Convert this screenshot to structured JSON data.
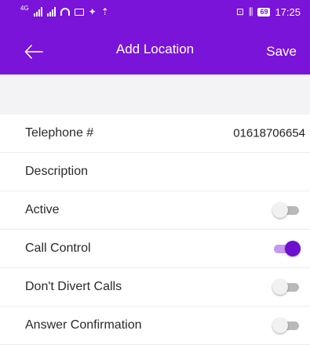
{
  "status_bar": {
    "network_label": "4G",
    "battery_level": "69",
    "time": "17:25"
  },
  "app_bar": {
    "title": "Add Location",
    "save_label": "Save",
    "back_icon": "arrow-left-icon"
  },
  "colors": {
    "primary": "#7a14d8",
    "toggle_on_thumb": "#6f0fd0",
    "toggle_on_track": "#c49af0",
    "toggle_off_track": "#b9b9b9",
    "toggle_off_thumb": "#f1f1f1"
  },
  "fields": {
    "telephone": {
      "label": "Telephone #",
      "value": "01618706654"
    },
    "description": {
      "label": "Description",
      "value": ""
    },
    "active": {
      "label": "Active",
      "on": false
    },
    "call_control": {
      "label": "Call Control",
      "on": true
    },
    "dont_divert": {
      "label": "Don't Divert Calls",
      "on": false
    },
    "answer_confirmation": {
      "label": "Answer Confirmation",
      "on": false
    }
  }
}
